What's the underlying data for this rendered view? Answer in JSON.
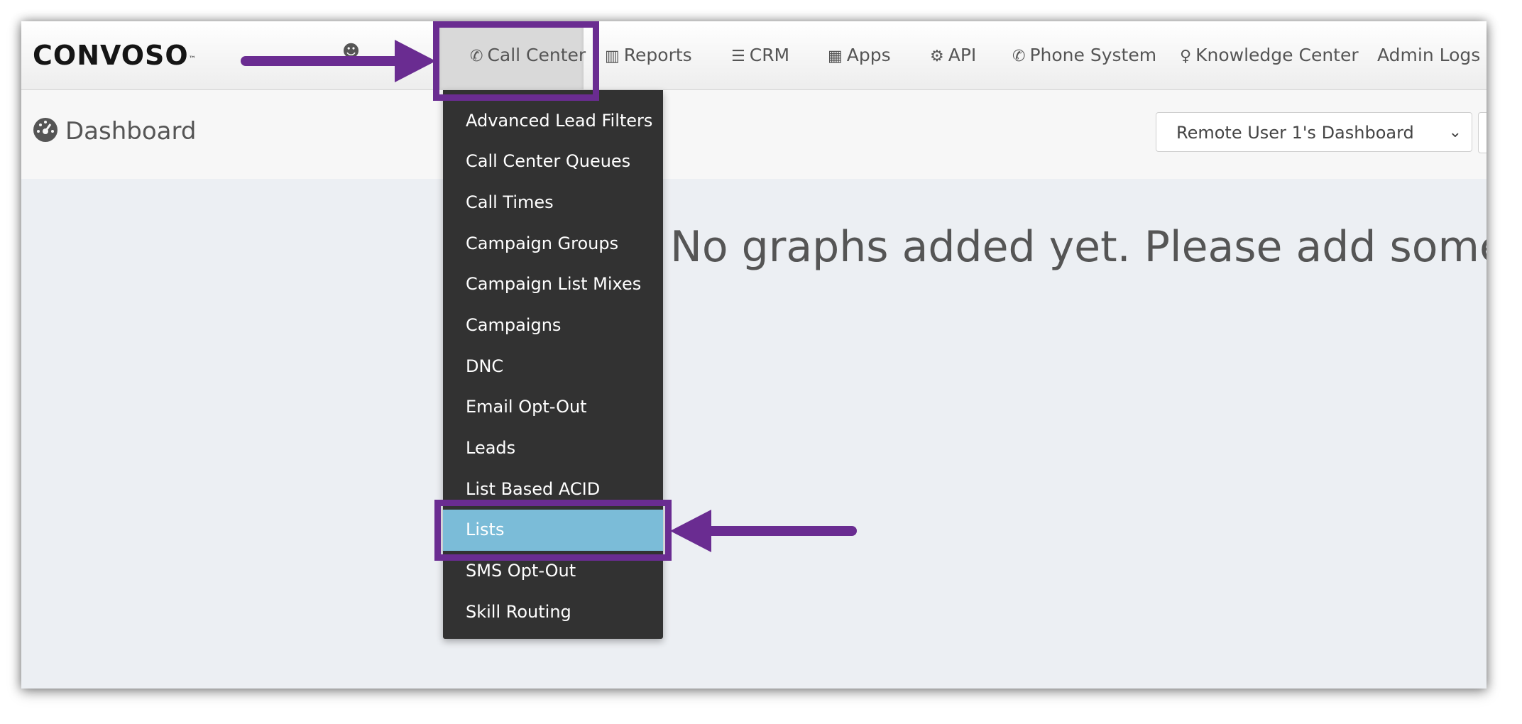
{
  "app": {
    "logo_text": "CONVOSO",
    "logo_tm": "™"
  },
  "nav": {
    "hidden_item_icon": "user-icon",
    "items": [
      {
        "label": "Call Center",
        "icon": "phone-icon",
        "glyph": "✆"
      },
      {
        "label": "Reports",
        "icon": "bar-chart-icon",
        "glyph": "▥"
      },
      {
        "label": "CRM",
        "icon": "list-icon",
        "glyph": "☰"
      },
      {
        "label": "Apps",
        "icon": "grid-icon",
        "glyph": "▦"
      },
      {
        "label": "API",
        "icon": "gear-icon",
        "glyph": "⚙"
      },
      {
        "label": "Phone System",
        "icon": "phone-icon",
        "glyph": "✆"
      },
      {
        "label": "Knowledge Center",
        "icon": "lightbulb-icon",
        "glyph": "♀"
      },
      {
        "label": "Admin Logs",
        "icon": "",
        "glyph": ""
      }
    ]
  },
  "dashboard": {
    "title": "Dashboard",
    "title_icon": "dashboard-gauge-icon",
    "selector_value": "Remote User 1's Dashboard",
    "empty_message": "No graphs added yet. Please add some."
  },
  "dropdown": {
    "items": [
      "Advanced Lead Filters",
      "Call Center Queues",
      "Call Times",
      "Campaign Groups",
      "Campaign List Mixes",
      "Campaigns",
      "DNC",
      "Email Opt-Out",
      "Leads",
      "List Based ACID",
      "Lists",
      "SMS Opt-Out",
      "Skill Routing"
    ],
    "selected": "Lists"
  },
  "colors": {
    "annotation": "#6a2c91",
    "selected_bg": "#7bbcd8",
    "dropdown_bg": "#323232"
  }
}
